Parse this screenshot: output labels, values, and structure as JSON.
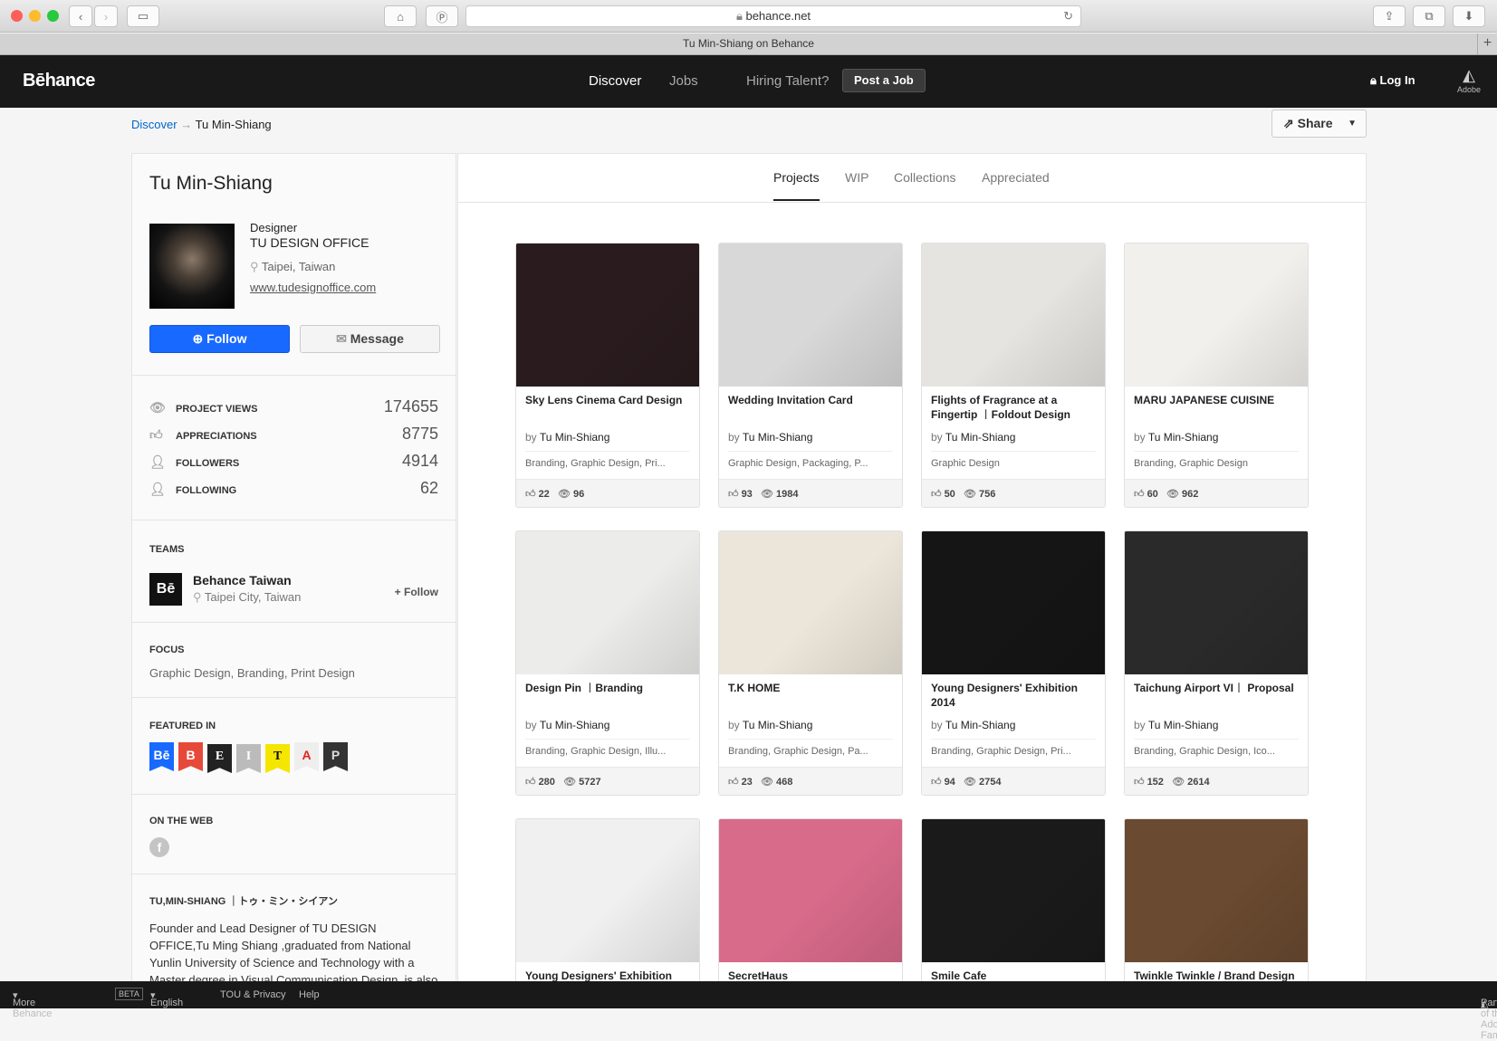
{
  "browser": {
    "url": "behance.net",
    "tab_title": "Tu Min-Shiang on Behance"
  },
  "nav": {
    "logo": "Bēhance",
    "discover": "Discover",
    "jobs": "Jobs",
    "hiring": "Hiring Talent?",
    "post_job": "Post a Job",
    "login": "Log In",
    "adobe": "Adobe"
  },
  "breadcrumb": {
    "root": "Discover",
    "arrow": "→",
    "current": "Tu Min-Shiang"
  },
  "share_label": "Share",
  "profile": {
    "name": "Tu Min-Shiang",
    "occupation": "Designer",
    "company": "TU DESIGN OFFICE",
    "location": "Taipei, Taiwan",
    "website": "www.tudesignoffice.com",
    "follow": "Follow",
    "message": "Message"
  },
  "stats": [
    {
      "label": "PROJECT VIEWS",
      "value": "174655"
    },
    {
      "label": "APPRECIATIONS",
      "value": "8775"
    },
    {
      "label": "FOLLOWERS",
      "value": "4914"
    },
    {
      "label": "FOLLOWING",
      "value": "62"
    }
  ],
  "teams": {
    "heading": "TEAMS",
    "name": "Behance Taiwan",
    "location": "Taipei City, Taiwan",
    "follow": "+ Follow",
    "logo": "Bē"
  },
  "focus": {
    "heading": "FOCUS",
    "value": "Graphic Design, Branding, Print Design"
  },
  "featured": {
    "heading": "FEATURED IN",
    "badges": [
      "Bē",
      "B",
      "E",
      "I",
      "T",
      "A",
      "P"
    ]
  },
  "web": {
    "heading": "ON THE WEB"
  },
  "about": {
    "heading": "TU,MIN-SHIANG ｜トゥ・ミン・シイアン",
    "text": "Founder and Lead Designer of TU DESIGN OFFICE,Tu Ming Shiang ,graduated from National Yunlin University of Science and Technology with a Master degree in Visual Communication Design, is also a"
  },
  "tabs": [
    "Projects",
    "WIP",
    "Collections",
    "Appreciated"
  ],
  "by_label": "by",
  "projects": [
    {
      "title": "Sky Lens Cinema Card Design",
      "owner": "Tu Min-Shiang",
      "fields": "Branding, Graphic Design, Pri...",
      "likes": "22",
      "views": "96"
    },
    {
      "title": "Wedding Invitation Card",
      "owner": "Tu Min-Shiang",
      "fields": "Graphic Design, Packaging, P...",
      "likes": "93",
      "views": "1984"
    },
    {
      "title": "Flights of Fragrance at a Fingertip ︱Foldout Design",
      "owner": "Tu Min-Shiang",
      "fields": "Graphic Design",
      "likes": "50",
      "views": "756"
    },
    {
      "title": "MARU JAPANESE CUISINE",
      "owner": "Tu Min-Shiang",
      "fields": "Branding, Graphic Design",
      "likes": "60",
      "views": "962"
    },
    {
      "title": "Design Pin ︱Branding",
      "owner": "Tu Min-Shiang",
      "fields": "Branding, Graphic Design, Illu...",
      "likes": "280",
      "views": "5727"
    },
    {
      "title": "T.K HOME",
      "owner": "Tu Min-Shiang",
      "fields": "Branding, Graphic Design, Pa...",
      "likes": "23",
      "views": "468"
    },
    {
      "title": "Young Designers' Exhibition 2014",
      "owner": "Tu Min-Shiang",
      "fields": "Branding, Graphic Design, Pri...",
      "likes": "94",
      "views": "2754"
    },
    {
      "title": "Taichung Airport VI︱ Proposal",
      "owner": "Tu Min-Shiang",
      "fields": "Branding, Graphic Design, Ico...",
      "likes": "152",
      "views": "2614"
    },
    {
      "title": "Young Designers' Exhibition",
      "owner": "Tu Min-Shiang",
      "fields": "",
      "likes": "",
      "views": ""
    },
    {
      "title": "SecretHaus",
      "owner": "Tu Min-Shiang",
      "fields": "",
      "likes": "",
      "views": ""
    },
    {
      "title": "Smile Cafe",
      "owner": "Tu Min-Shiang",
      "fields": "",
      "likes": "",
      "views": ""
    },
    {
      "title": "Twinkle Twinkle / Brand Design",
      "owner": "Tu Min-Shiang",
      "fields": "",
      "likes": "",
      "views": ""
    }
  ],
  "thumb_colors": [
    "#2a1c1e",
    "#d8d8d8",
    "#e6e4e0",
    "#f2f0ec",
    "#ececea",
    "#ece6da",
    "#151515",
    "#2a2a2a",
    "#f0f0f0",
    "#d86a8a",
    "#1a1a1a",
    "#6a4a30"
  ],
  "footer": {
    "more": "More Behance",
    "beta": "BETA",
    "lang": "English",
    "tou": "TOU & Privacy",
    "help": "Help",
    "family": "Part of the Adobe Family"
  }
}
